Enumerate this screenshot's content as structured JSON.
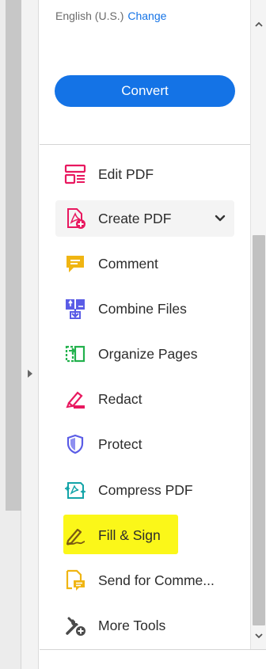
{
  "language": {
    "text": "English (U.S.)",
    "change_label": "Change"
  },
  "convert_button": {
    "label": "Convert"
  },
  "colors": {
    "accent": "#1473e6",
    "highlight": "#fbf719"
  },
  "tools": [
    {
      "label": "Edit PDF",
      "icon": "edit-pdf-icon"
    },
    {
      "label": "Create PDF",
      "icon": "create-pdf-icon",
      "expandable": true
    },
    {
      "label": "Comment",
      "icon": "comment-icon"
    },
    {
      "label": "Combine Files",
      "icon": "combine-files-icon"
    },
    {
      "label": "Organize Pages",
      "icon": "organize-pages-icon"
    },
    {
      "label": "Redact",
      "icon": "redact-icon"
    },
    {
      "label": "Protect",
      "icon": "protect-icon"
    },
    {
      "label": "Compress PDF",
      "icon": "compress-pdf-icon"
    },
    {
      "label": "Fill & Sign",
      "icon": "fill-sign-icon",
      "highlighted": true
    },
    {
      "label": "Send for Comme...",
      "icon": "send-for-comment-icon"
    },
    {
      "label": "More Tools",
      "icon": "more-tools-icon"
    }
  ]
}
